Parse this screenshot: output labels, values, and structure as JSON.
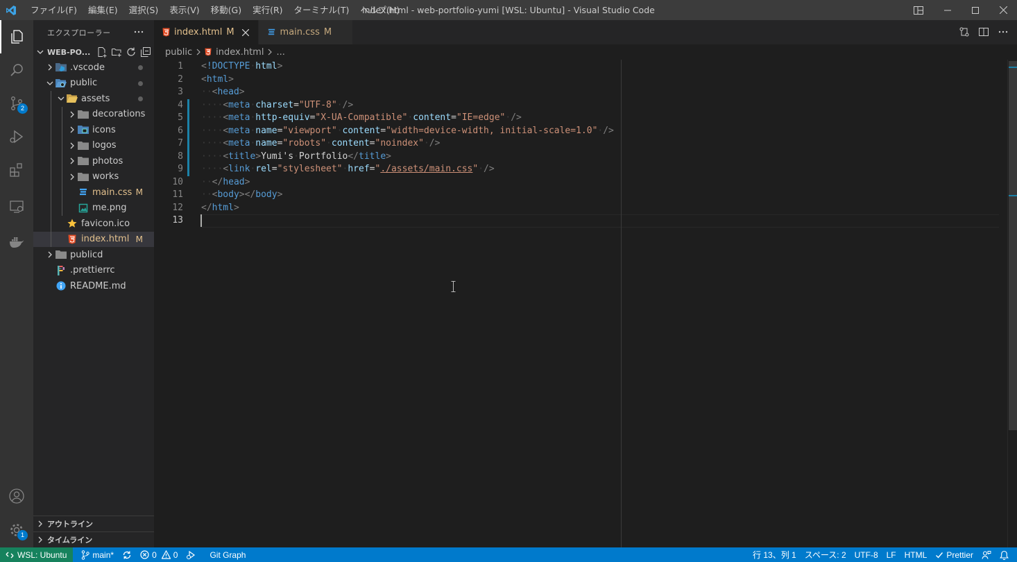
{
  "titlebar": {
    "menu": [
      "ファイル(F)",
      "編集(E)",
      "選択(S)",
      "表示(V)",
      "移動(G)",
      "実行(R)",
      "ターミナル(T)",
      "ヘルプ(H)"
    ],
    "title": "index.html - web-portfolio-yumi [WSL: Ubuntu] - Visual Studio Code"
  },
  "activitybar": {
    "scm_badge": "2",
    "settings_badge": "1"
  },
  "sidebar": {
    "header": "エクスプローラー",
    "folder": "WEB-PO...",
    "tree": [
      {
        "label": ".vscode",
        "depth": 0,
        "kind": "folder",
        "open": false,
        "dot": true
      },
      {
        "label": "public",
        "depth": 0,
        "kind": "folder",
        "open": true,
        "dot": true
      },
      {
        "label": "assets",
        "depth": 1,
        "kind": "folder",
        "open": true,
        "dot": true
      },
      {
        "label": "decorations",
        "depth": 2,
        "kind": "folder",
        "open": false
      },
      {
        "label": "icons",
        "depth": 2,
        "kind": "folder",
        "open": false
      },
      {
        "label": "logos",
        "depth": 2,
        "kind": "folder",
        "open": false
      },
      {
        "label": "photos",
        "depth": 2,
        "kind": "folder",
        "open": false
      },
      {
        "label": "works",
        "depth": 2,
        "kind": "folder",
        "open": false
      },
      {
        "label": "main.css",
        "depth": 2,
        "kind": "css",
        "mod": "M"
      },
      {
        "label": "me.png",
        "depth": 2,
        "kind": "png"
      },
      {
        "label": "favicon.ico",
        "depth": 1,
        "kind": "ico"
      },
      {
        "label": "index.html",
        "depth": 1,
        "kind": "html",
        "mod": "M",
        "selected": true
      },
      {
        "label": "publicd",
        "depth": 0,
        "kind": "folder",
        "open": false
      },
      {
        "label": ".prettierrc",
        "depth": 0,
        "kind": "prettier"
      },
      {
        "label": "README.md",
        "depth": 0,
        "kind": "md"
      }
    ],
    "outline": "アウトライン",
    "timeline": "タイムライン"
  },
  "tabs": [
    {
      "label": "index.html",
      "mod": "M",
      "active": true,
      "kind": "html"
    },
    {
      "label": "main.css",
      "mod": "M",
      "active": false,
      "kind": "css"
    }
  ],
  "breadcrumbs": {
    "folder": "public",
    "file": "index.html",
    "more": "..."
  },
  "code": {
    "lines": [
      "<!DOCTYPE html>",
      "<html>",
      "  <head>",
      "    <meta charset=\"UTF-8\" />",
      "    <meta http-equiv=\"X-UA-Compatible\" content=\"IE=edge\" />",
      "    <meta name=\"viewport\" content=\"width=device-width, initial-scale=1.0\" />",
      "    <meta name=\"robots\" content=\"noindex\" />",
      "    <title>Yumi's Portfolio</title>",
      "    <link rel=\"stylesheet\" href=\"./assets/main.css\" />",
      "  </head>",
      "  <body></body>",
      "</html>",
      ""
    ],
    "current_line": 13
  },
  "statusbar": {
    "remote": "WSL: Ubuntu",
    "branch": "main*",
    "errors": "0",
    "warnings": "0",
    "git_graph": "Git Graph",
    "position": "行 13、列 1",
    "spaces": "スペース: 2",
    "encoding": "UTF-8",
    "eol": "LF",
    "language": "HTML",
    "prettier": "Prettier"
  },
  "colors": {
    "accent": "#007acc",
    "remote": "#16825d",
    "modified": "#e2c08d",
    "html_icon": "#e44d26",
    "css_icon": "#42a5f5"
  }
}
